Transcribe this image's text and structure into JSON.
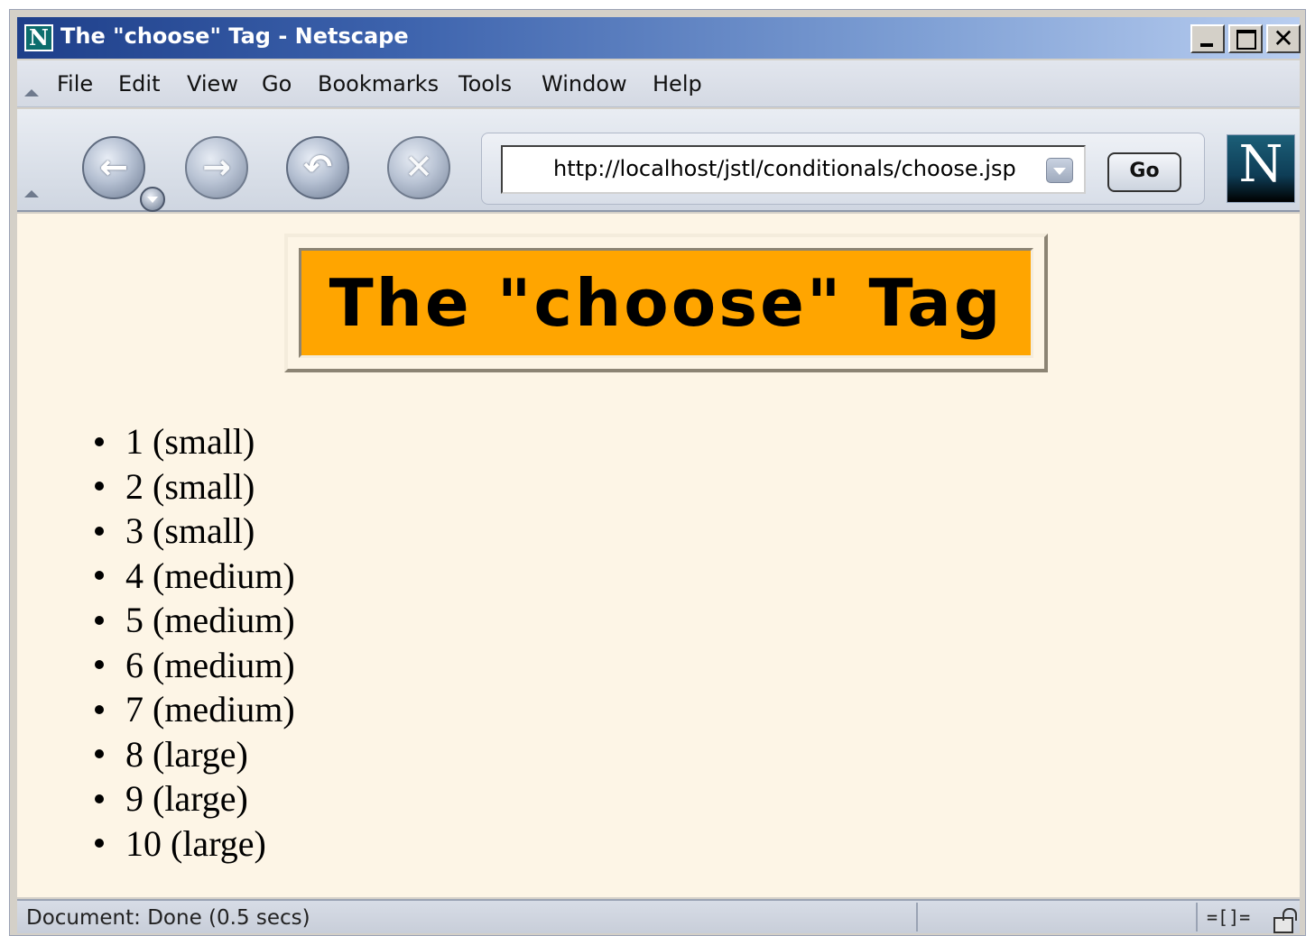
{
  "window": {
    "title": "The \"choose\" Tag - Netscape",
    "app_icon_letter": "N"
  },
  "menu": {
    "items": [
      "File",
      "Edit",
      "View",
      "Go",
      "Bookmarks",
      "Tools",
      "Window",
      "Help"
    ]
  },
  "toolbar": {
    "url": "http://localhost/jstl/conditionals/choose.jsp",
    "go_label": "Go",
    "logo_letter": "N",
    "icons": [
      "back-icon",
      "forward-icon",
      "reload-icon",
      "stop-icon"
    ]
  },
  "page": {
    "heading": "The \"choose\" Tag",
    "heading_bg": "#ffa500",
    "background": "#fdf5e6",
    "items": [
      "1 (small)",
      "2 (small)",
      "3 (small)",
      "4 (medium)",
      "5 (medium)",
      "6 (medium)",
      "7 (medium)",
      "8 (large)",
      "9 (large)",
      "10 (large)"
    ]
  },
  "status": {
    "text": "Document: Done (0.5 secs)"
  }
}
